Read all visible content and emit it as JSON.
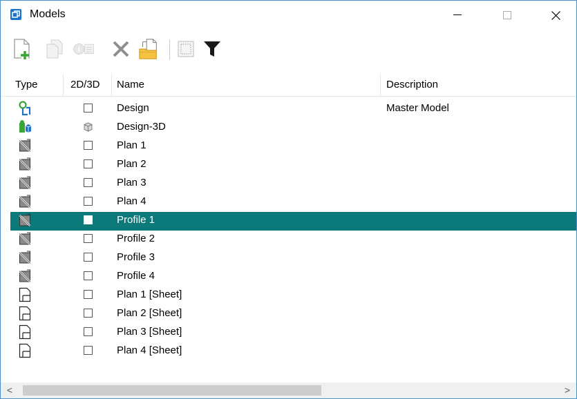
{
  "window": {
    "title": "Models",
    "accent": "#1a73c8",
    "controls": {
      "minimize": "—",
      "maximize": "☐",
      "close": "✕"
    }
  },
  "toolbar": {
    "items": [
      {
        "icon": "new-model-icon"
      },
      {
        "icon": "copy-model-icon"
      },
      {
        "icon": "model-properties-icon"
      },
      {
        "icon": "delete-model-icon"
      },
      {
        "icon": "import-model-icon"
      },
      {
        "icon": "select-all-icon"
      },
      {
        "icon": "filter-icon"
      }
    ]
  },
  "columns": {
    "type": "Type",
    "dim": "2D/3D",
    "name": "Name",
    "description": "Description"
  },
  "models": [
    {
      "type": "design-model-icon",
      "dim": "2d",
      "name": "Design",
      "description": "Master Model"
    },
    {
      "type": "3d-design-model-icon",
      "dim": "3d",
      "name": "Design-3D",
      "description": ""
    },
    {
      "type": "drawing-model-icon",
      "dim": "2d",
      "name": "Plan 1",
      "description": ""
    },
    {
      "type": "drawing-model-icon",
      "dim": "2d",
      "name": "Plan 2",
      "description": ""
    },
    {
      "type": "drawing-model-icon",
      "dim": "2d",
      "name": "Plan 3",
      "description": ""
    },
    {
      "type": "drawing-model-icon",
      "dim": "2d",
      "name": "Plan 4",
      "description": ""
    },
    {
      "type": "drawing-model-icon",
      "dim": "2d",
      "name": "Profile 1",
      "description": "",
      "selected": true
    },
    {
      "type": "drawing-model-icon",
      "dim": "2d",
      "name": "Profile 2",
      "description": ""
    },
    {
      "type": "drawing-model-icon",
      "dim": "2d",
      "name": "Profile 3",
      "description": ""
    },
    {
      "type": "drawing-model-icon",
      "dim": "2d",
      "name": "Profile 4",
      "description": ""
    },
    {
      "type": "sheet-model-icon",
      "dim": "2d",
      "name": "Plan 1 [Sheet]",
      "description": ""
    },
    {
      "type": "sheet-model-icon",
      "dim": "2d",
      "name": "Plan 2 [Sheet]",
      "description": ""
    },
    {
      "type": "sheet-model-icon",
      "dim": "2d",
      "name": "Plan 3 [Sheet]",
      "description": ""
    },
    {
      "type": "sheet-model-icon",
      "dim": "2d",
      "name": "Plan 4 [Sheet]",
      "description": ""
    }
  ],
  "scrollbar": {
    "left": "<",
    "right": ">"
  },
  "colors": {
    "selection": "#0c7a7a",
    "selection_text": "#ffffff"
  }
}
